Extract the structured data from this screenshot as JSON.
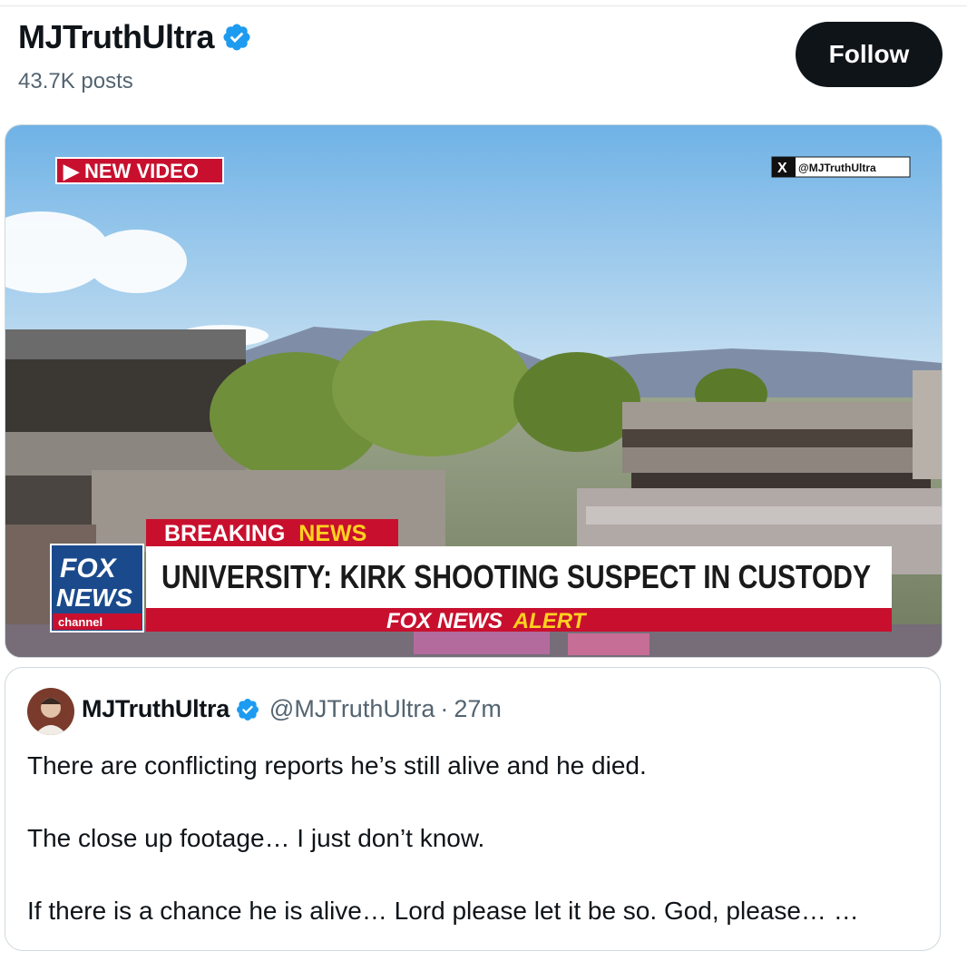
{
  "header": {
    "display_name": "MJTruthUltra",
    "post_count": "43.7K posts",
    "follow_label": "Follow"
  },
  "media": {
    "tag_label": "▶ NEW VIDEO",
    "watermark": "@MJTruthUltra",
    "breaking_word1": "BREAKING",
    "breaking_word2": "NEWS",
    "headline": "UNIVERSITY: KIRK SHOOTING SUSPECT IN CUSTODY",
    "alert_word1": "FOX NEWS",
    "alert_word2": "ALERT",
    "logo_line1": "FOX",
    "logo_line2": "NEWS",
    "logo_line3": "channel"
  },
  "quote": {
    "display_name": "MJTruthUltra",
    "handle": "@MJTruthUltra",
    "separator": "·",
    "time": "27m",
    "lines": [
      "There are conflicting reports he’s still alive and he died.",
      "The close up footage… I just don’t know.",
      "If there is a chance he is alive… Lord please let it be so. God, please… …"
    ]
  },
  "colors": {
    "verified": "#1d9bf0",
    "follow_bg": "#0f1419",
    "fox_red": "#c8102e",
    "fox_blue": "#1a4a8c",
    "alert_yellow": "#ffd21f"
  },
  "icons": {
    "verified": "verified-badge-icon",
    "x_logo": "x-logo-icon",
    "play": "play-triangle-icon"
  }
}
